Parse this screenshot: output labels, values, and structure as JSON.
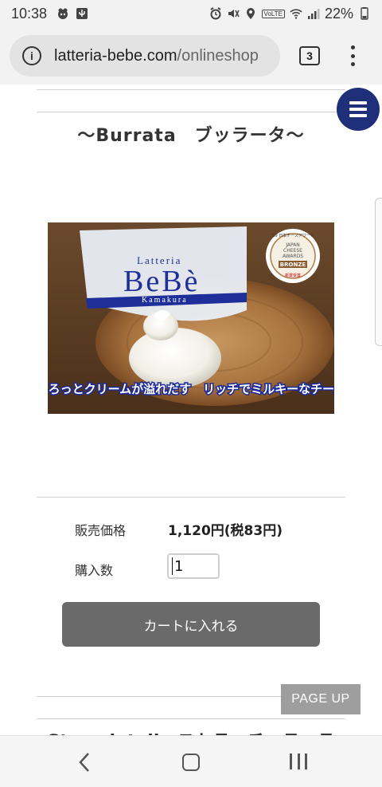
{
  "statusbar": {
    "time": "10:38",
    "battery": "22%",
    "volte": "VoLTE"
  },
  "browser": {
    "url_domain": "latteria-bebe.com",
    "url_path": "/onlineshop",
    "tab_count": "3"
  },
  "product": {
    "title": "〜Burrata　ブッラータ〜",
    "image": {
      "brand_small": "Latteria",
      "brand_big": "BeBè",
      "brand_place": "Kamakura",
      "award_top": "'19 日本チーズアワード",
      "award_mid1": "JAPAN",
      "award_mid2": "CHEESE",
      "award_mid3": "AWARDS",
      "award_rank": "BRONZE",
      "award_bottom": "新賞受賞",
      "caption": "とろっとクリームが溢れだす　リッチでミルキーなチーズ"
    },
    "price_label": "販売価格",
    "price_value": "1,120円(税83円)",
    "qty_label": "購入数",
    "qty_value": "1",
    "cart_button": "カートに入れる"
  },
  "page_up": "PAGE UP",
  "next_product_title": "Stracciatella ストラッチャテッラ",
  "colors": {
    "accent_navy": "#1f2f7a",
    "button_gray": "#6a6a6a",
    "pageup_gray": "#9e9e9e"
  }
}
